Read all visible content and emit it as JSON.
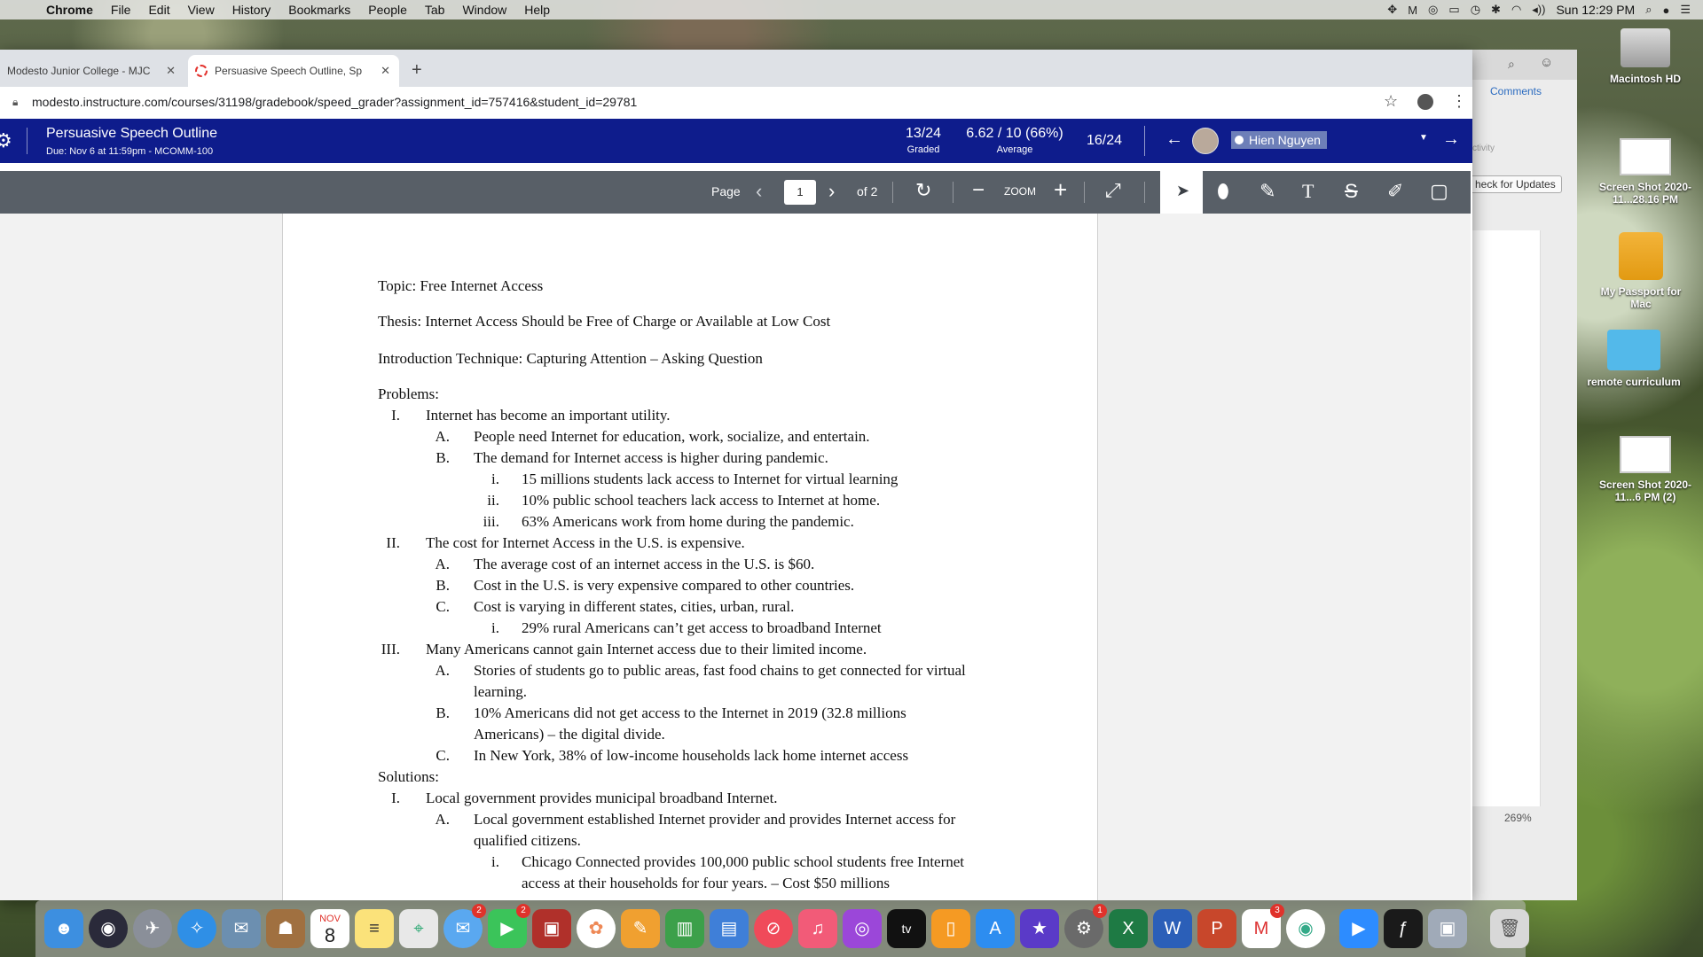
{
  "menubar": {
    "app": "Chrome",
    "items": [
      "File",
      "Edit",
      "View",
      "History",
      "Bookmarks",
      "People",
      "Tab",
      "Window",
      "Help"
    ],
    "clock": "Sun 12:29 PM"
  },
  "browser": {
    "tabs": [
      {
        "title": "Modesto Junior College - MJC"
      },
      {
        "title": "Persuasive Speech Outline, Sp"
      }
    ],
    "url": "modesto.instructure.com/courses/31198/gradebook/speed_grader?assignment_id=757416&student_id=29781"
  },
  "speedgrader": {
    "assignment_title": "Persuasive Speech Outline",
    "due": "Due: Nov 6 at 11:59pm - MCOMM-100",
    "graded_value": "13/24",
    "graded_label": "Graded",
    "average_value": "6.62 / 10 (66%)",
    "average_label": "Average",
    "position": "16/24",
    "student_name": "Hien Nguyen"
  },
  "viewer": {
    "page_label": "Page",
    "page_value": "1",
    "of_label": "of 2",
    "zoom_label": "ZOOM"
  },
  "document": {
    "topic": "Topic: Free Internet Access",
    "thesis": "Thesis: Internet Access Should be Free of Charge or Available at Low Cost",
    "intro": "Introduction Technique: Capturing Attention – Asking Question",
    "problems_heading": "Problems:",
    "lines": [
      {
        "num": "I.",
        "text": "Internet has become an important utility."
      },
      {
        "num": "A.",
        "text": "People need Internet for education, work, socialize, and entertain."
      },
      {
        "num": "B.",
        "text": "The demand for Internet access is higher during pandemic."
      },
      {
        "num": "i.",
        "text": "15 millions students lack access to Internet for virtual learning"
      },
      {
        "num": "ii.",
        "text": "10% public school teachers lack access to Internet at home."
      },
      {
        "num": "iii.",
        "text": "63% Americans work from home during the pandemic."
      },
      {
        "num": "II.",
        "text": "The cost for Internet Access in the U.S. is expensive."
      },
      {
        "num": "A.",
        "text": "The average cost of an internet access in the U.S. is $60."
      },
      {
        "num": "B.",
        "text": "Cost in the U.S. is very expensive compared to other countries."
      },
      {
        "num": "C.",
        "text": "Cost is varying in different states, cities, urban, rural."
      },
      {
        "num": "i.",
        "text": "29% rural Americans can’t get access to broadband Internet"
      },
      {
        "num": "III.",
        "text": "Many Americans cannot gain Internet access due to their limited income."
      },
      {
        "num": "A.",
        "text": "Stories of students go to public areas, fast food chains to get connected for virtual"
      },
      {
        "num": "",
        "text": "learning."
      },
      {
        "num": "B.",
        "text": "10% Americans did not get access to the Internet in 2019 (32.8 millions"
      },
      {
        "num": "",
        "text": "Americans) – the digital divide."
      },
      {
        "num": "C.",
        "text": "In New York, 38% of low-income households lack home internet access"
      }
    ],
    "solutions_heading": "Solutions:",
    "solution_lines": [
      {
        "num": "I.",
        "text": "Local government provides municipal broadband Internet."
      },
      {
        "num": "A.",
        "text": "Local government established Internet provider and provides Internet access for"
      },
      {
        "num": "",
        "text": "qualified citizens."
      },
      {
        "num": "i.",
        "text": "Chicago Connected provides 100,000 public school students free Internet"
      },
      {
        "num": "",
        "text": "access at their households for four years. – Cost $50 millions"
      }
    ]
  },
  "side_panel": {
    "comments_label": "Comments",
    "activity_label": "ctivity",
    "updates_label": "heck for Updates",
    "zoom_pct": "269%"
  },
  "desktop_icons": [
    {
      "label": "Macintosh HD"
    },
    {
      "label": "Screen Shot 2020-11...28.16 PM"
    },
    {
      "label": "My Passport for Mac"
    },
    {
      "label": "remote curriculum"
    },
    {
      "label": "Screen Shot 2020-11...6 PM (2)"
    }
  ],
  "dock": {
    "calendar_month": "NOV",
    "calendar_day": "8",
    "badges": {
      "messages": "2",
      "facetime": "2",
      "prefs": "1",
      "gmail": "3"
    }
  }
}
